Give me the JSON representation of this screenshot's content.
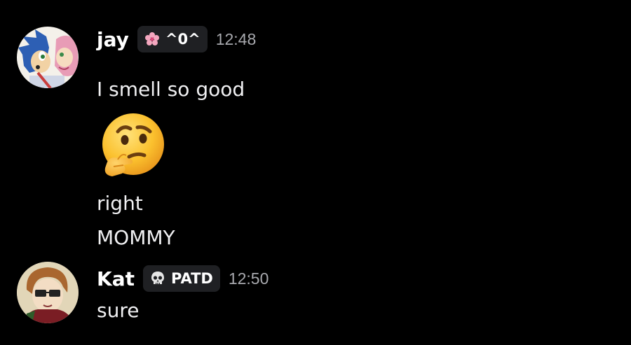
{
  "messages": [
    {
      "username": "jay",
      "tag": {
        "icon": "cherry-blossom-icon",
        "text": "^0^"
      },
      "timestamp": "12:48",
      "avatar": "sonic-amy-avatar",
      "lines": [
        "I smell so good",
        "right",
        "MOMMY"
      ],
      "emoji": "thinking-face-emoji"
    },
    {
      "username": "Kat",
      "tag": {
        "icon": "skull-icon",
        "text": "PATD"
      },
      "timestamp": "12:50",
      "avatar": "glasses-character-avatar",
      "lines": [
        "sure"
      ]
    }
  ],
  "colors": {
    "background": "#000000",
    "tag_background": "#1f2023",
    "timestamp": "#a8a9ae",
    "text": "#f0f0f2"
  }
}
